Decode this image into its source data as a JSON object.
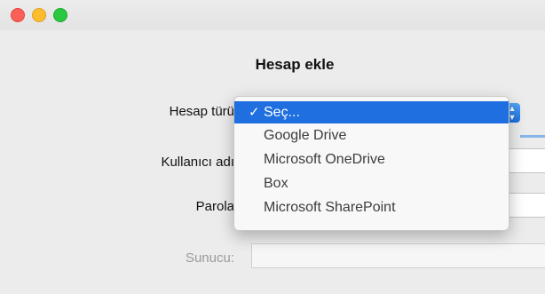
{
  "window": {
    "controls": [
      "close",
      "minimize",
      "zoom"
    ]
  },
  "dialog": {
    "title": "Hesap ekle"
  },
  "form": {
    "account_type_label": "Hesap türü",
    "username_label": "Kullanıcı adı",
    "password_label": "Parola",
    "server_label": "Sunucu:"
  },
  "menu": {
    "selected_index": 0,
    "items": [
      {
        "label": "Seç...",
        "checked": true
      },
      {
        "label": "Google Drive"
      },
      {
        "label": "Microsoft OneDrive"
      },
      {
        "label": "Box"
      },
      {
        "label": "Microsoft SharePoint"
      }
    ],
    "checkmark": "✓"
  },
  "colors": {
    "selection": "#1f6fe0",
    "close": "#fc5f57",
    "minimize": "#fdbc2e",
    "zoom": "#29c840"
  }
}
